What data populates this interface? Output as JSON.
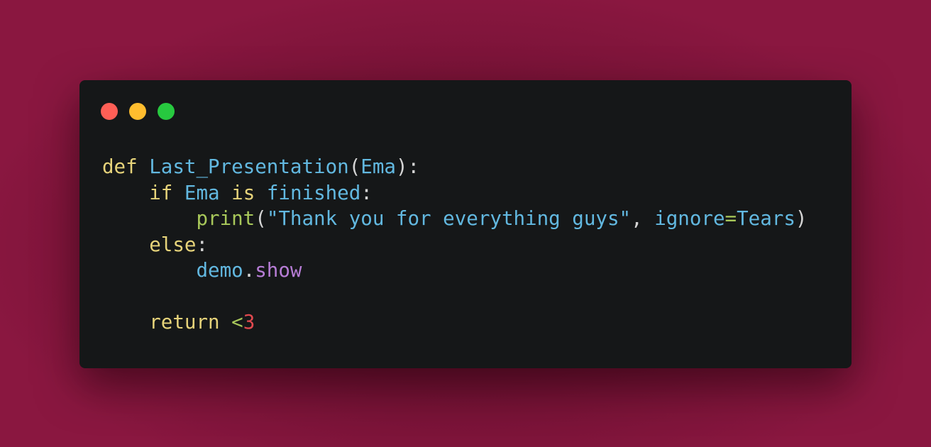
{
  "window": {
    "controls": [
      {
        "name": "close",
        "color": "#ff5f56"
      },
      {
        "name": "minimize",
        "color": "#ffbd2e"
      },
      {
        "name": "maximize",
        "color": "#27c93f"
      }
    ]
  },
  "code": {
    "language": "python",
    "lines": [
      {
        "tokens": [
          [
            "def",
            "kw"
          ],
          [
            " ",
            "punct"
          ],
          [
            "Last_Presentation",
            "fn"
          ],
          [
            "(",
            "punct"
          ],
          [
            "Ema",
            "fn"
          ],
          [
            "):",
            "punct"
          ]
        ]
      },
      {
        "tokens": [
          [
            "    ",
            "punct"
          ],
          [
            "if",
            "kw"
          ],
          [
            " ",
            "punct"
          ],
          [
            "Ema",
            "fn"
          ],
          [
            " ",
            "punct"
          ],
          [
            "is",
            "kw"
          ],
          [
            " ",
            "punct"
          ],
          [
            "finished",
            "fn"
          ],
          [
            ":",
            "punct"
          ]
        ]
      },
      {
        "tokens": [
          [
            "        ",
            "punct"
          ],
          [
            "print",
            "builtin"
          ],
          [
            "(",
            "punct"
          ],
          [
            "\"Thank you for everything guys\"",
            "str"
          ],
          [
            ", ",
            "punct"
          ],
          [
            "ignore",
            "attr"
          ],
          [
            "=",
            "op"
          ],
          [
            "Tears",
            "fn"
          ],
          [
            ")",
            "punct"
          ]
        ]
      },
      {
        "tokens": [
          [
            "    ",
            "punct"
          ],
          [
            "else",
            "kw"
          ],
          [
            ":",
            "punct"
          ]
        ]
      },
      {
        "tokens": [
          [
            "        ",
            "punct"
          ],
          [
            "demo",
            "fn"
          ],
          [
            ".",
            "punct"
          ],
          [
            "show",
            "method"
          ]
        ]
      },
      {
        "tokens": []
      },
      {
        "tokens": [
          [
            "    ",
            "punct"
          ],
          [
            "return",
            "kw"
          ],
          [
            " ",
            "punct"
          ],
          [
            "<",
            "op"
          ],
          [
            "3",
            "num"
          ]
        ]
      }
    ]
  }
}
